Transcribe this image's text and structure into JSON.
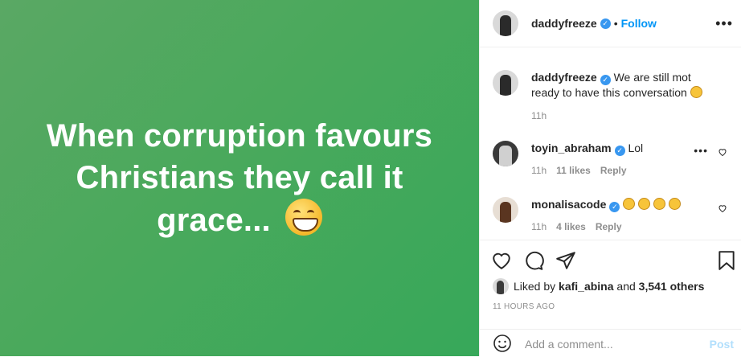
{
  "media": {
    "caption_lines": [
      "When corruption favours",
      "Christians they call it",
      "grace..."
    ],
    "emoji": "grinning-face-with-smiling-eyes",
    "background_color": "#46a85d"
  },
  "header": {
    "username": "daddyfreeze",
    "separator": "•",
    "follow_label": "Follow",
    "more_label": "•••"
  },
  "caption_comment": {
    "username": "daddyfreeze",
    "text": "We are still mot ready to have this conversation",
    "time": "11h"
  },
  "comments": [
    {
      "username": "toyin_abraham",
      "text": "Lol",
      "time": "11h",
      "likes": "11 likes",
      "reply_label": "Reply"
    },
    {
      "username": "monalisacode",
      "emoji_count": 4,
      "time": "11h",
      "likes": "4 likes",
      "reply_label": "Reply"
    }
  ],
  "likes": {
    "prefix": "Liked by",
    "user": "kafi_abina",
    "connector": "and",
    "others": "3,541 others"
  },
  "timestamp": "11 HOURS AGO",
  "add_comment": {
    "placeholder": "Add a comment...",
    "post_label": "Post"
  },
  "colors": {
    "link_blue": "#0095f6",
    "verified_blue": "#3897f0",
    "muted": "#8e8e8e"
  }
}
